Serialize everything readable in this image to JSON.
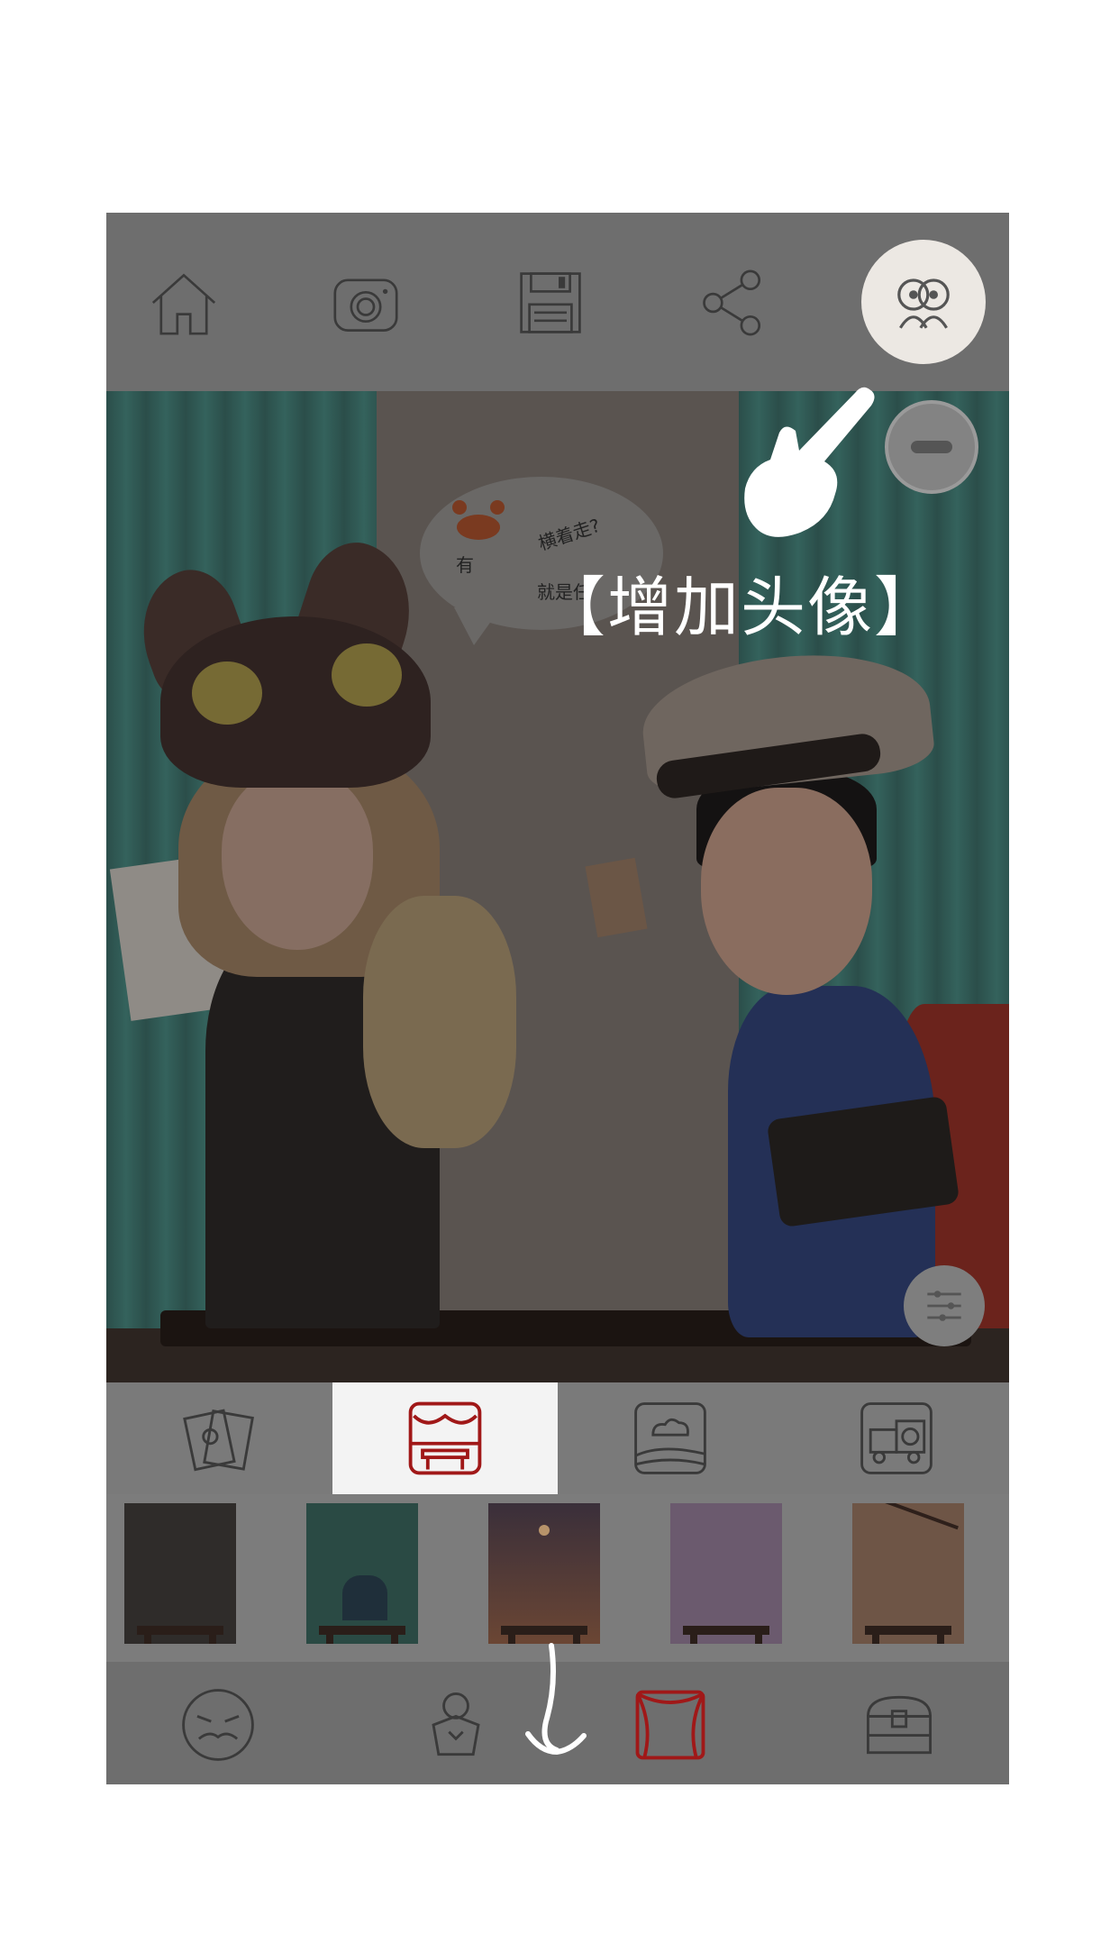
{
  "toolbar": {
    "items": [
      {
        "icon": "home-icon",
        "label": "Home"
      },
      {
        "icon": "camera-icon",
        "label": "Camera"
      },
      {
        "icon": "save-icon",
        "label": "Save"
      },
      {
        "icon": "share-icon",
        "label": "Share"
      }
    ],
    "add_face_icon": "add-face-icon"
  },
  "scene": {
    "bubble_line1": "横着走?",
    "bubble_line2": "有",
    "bubble_line3": "就是任"
  },
  "hint": {
    "text": "【增加头像】"
  },
  "tabs": [
    {
      "icon": "cards-icon",
      "active": false
    },
    {
      "icon": "stage-table-icon",
      "active": true
    },
    {
      "icon": "landscape-icon",
      "active": false
    },
    {
      "icon": "camera-truck-icon",
      "active": false
    }
  ],
  "thumbnails": [
    {
      "name": "dark-table",
      "bg": "#2f2c2a"
    },
    {
      "name": "teal-rock",
      "bg": "#2a4a44"
    },
    {
      "name": "dusk-table",
      "bg": "#5a3a2e"
    },
    {
      "name": "purple-table",
      "bg": "#6b5a6e"
    },
    {
      "name": "blossom-table",
      "bg": "#6e5546"
    }
  ],
  "bottomnav": [
    {
      "icon": "mustache-face-icon",
      "active": false
    },
    {
      "icon": "costume-icon",
      "active": false
    },
    {
      "icon": "curtain-icon",
      "active": true
    },
    {
      "icon": "treasure-chest-icon",
      "active": false
    }
  ],
  "colors": {
    "overlay_gray": "#7a7a7a",
    "active_red": "#a01818",
    "icon_stroke": "#3a3a3a",
    "hint_white": "#ffffff"
  }
}
